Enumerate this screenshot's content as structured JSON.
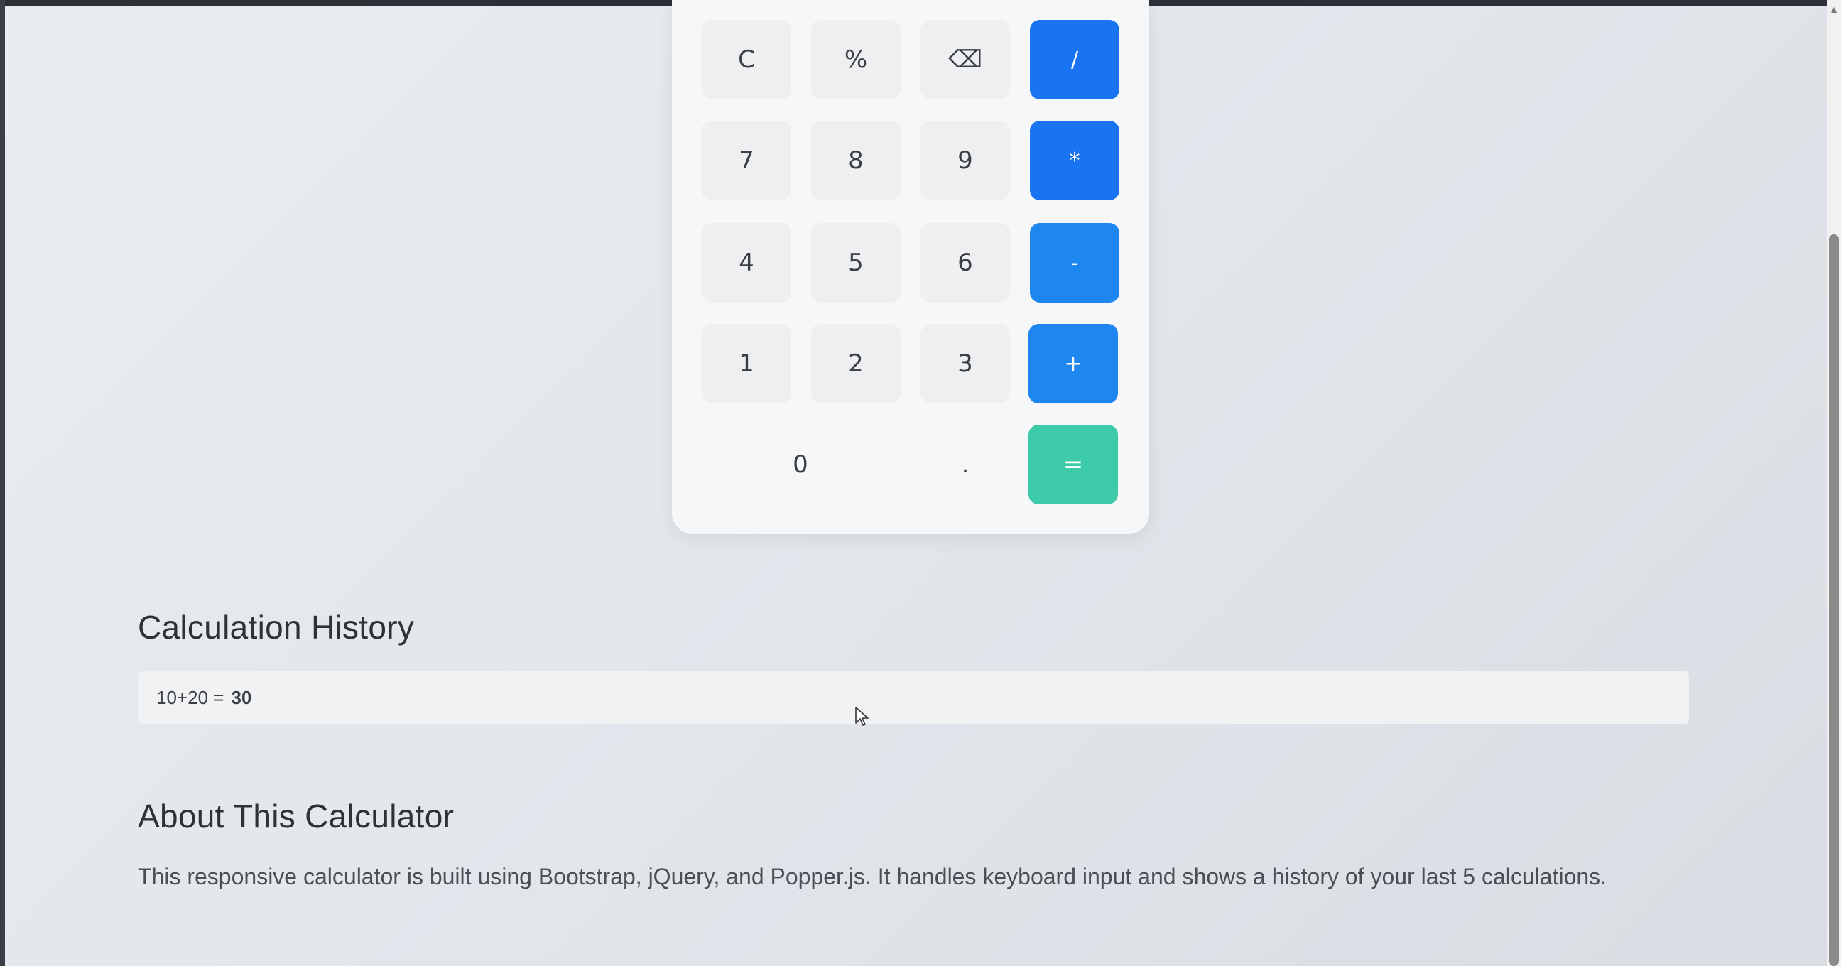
{
  "calculator": {
    "rows": [
      [
        {
          "label": "C",
          "kind": "func",
          "name": "clear-button"
        },
        {
          "label": "%",
          "kind": "func",
          "name": "percent-button"
        },
        {
          "label": "⌫",
          "kind": "func",
          "name": "backspace-button"
        },
        {
          "label": "/",
          "kind": "op",
          "name": "divide-button"
        }
      ],
      [
        {
          "label": "7",
          "kind": "digit",
          "name": "digit-7-button"
        },
        {
          "label": "8",
          "kind": "digit",
          "name": "digit-8-button"
        },
        {
          "label": "9",
          "kind": "digit",
          "name": "digit-9-button"
        },
        {
          "label": "*",
          "kind": "op",
          "name": "multiply-button"
        }
      ],
      [
        {
          "label": "4",
          "kind": "digit",
          "name": "digit-4-button"
        },
        {
          "label": "5",
          "kind": "digit",
          "name": "digit-5-button"
        },
        {
          "label": "6",
          "kind": "digit",
          "name": "digit-6-button"
        },
        {
          "label": "-",
          "kind": "op",
          "name": "subtract-button"
        }
      ],
      [
        {
          "label": "1",
          "kind": "digit",
          "name": "digit-1-button"
        },
        {
          "label": "2",
          "kind": "digit",
          "name": "digit-2-button"
        },
        {
          "label": "3",
          "kind": "digit",
          "name": "digit-3-button"
        },
        {
          "label": "+",
          "kind": "op",
          "name": "add-button"
        }
      ],
      [
        {
          "label": "0",
          "kind": "zero",
          "name": "digit-0-button"
        },
        {
          "label": ".",
          "kind": "dot",
          "name": "decimal-button"
        },
        {
          "label": "=",
          "kind": "equals",
          "name": "equals-button"
        }
      ]
    ],
    "colors": {
      "operator": "#1a73f0",
      "equals": "#3ccaa8"
    }
  },
  "history": {
    "title": "Calculation History",
    "entries": [
      {
        "expression": "10+20 =",
        "result": "30"
      }
    ]
  },
  "about": {
    "title": "About This Calculator",
    "text": "This responsive calculator is built using Bootstrap, jQuery, and Popper.js. It handles keyboard input and shows a history of your last 5 calculations."
  },
  "icons": {
    "backspace": "backspace-icon",
    "cursor": "mouse-pointer-icon",
    "scroll_up": "chevron-up-icon"
  }
}
